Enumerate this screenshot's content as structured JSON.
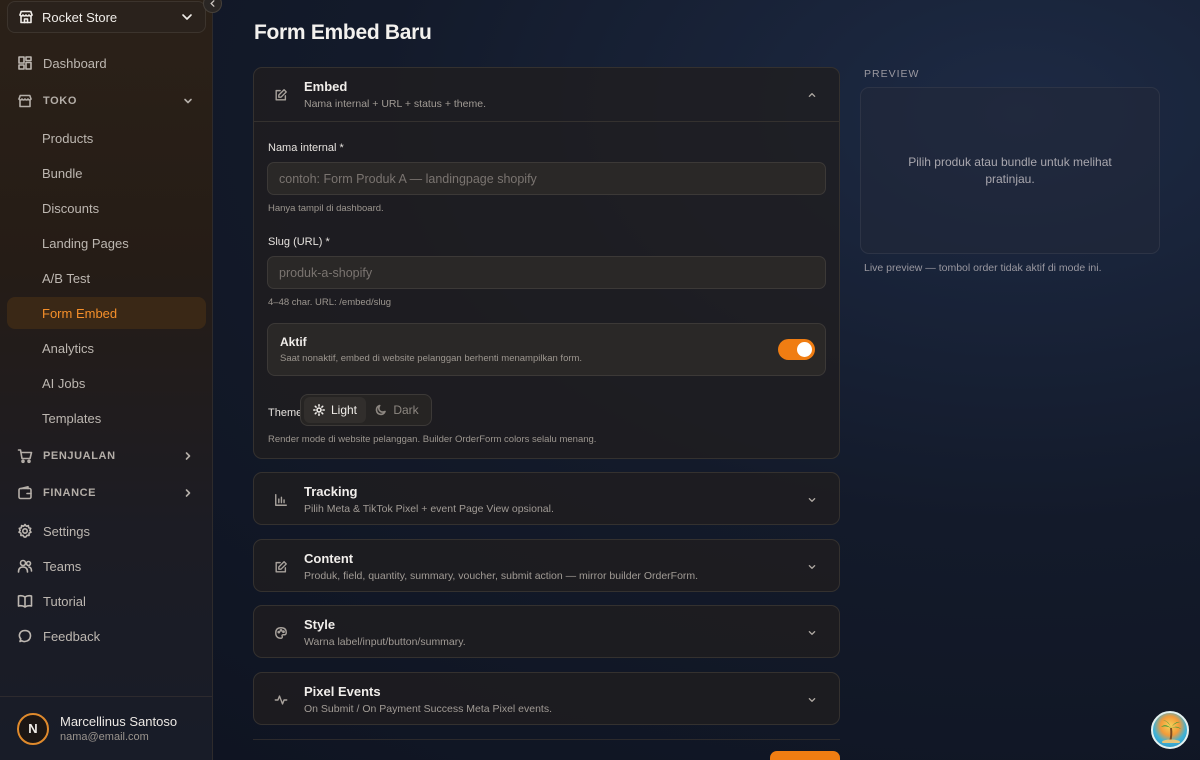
{
  "sidebar": {
    "store": "Rocket Store",
    "items": {
      "dashboard": "Dashboard",
      "toko": "TOKO",
      "products": "Products",
      "bundle": "Bundle",
      "discounts": "Discounts",
      "landing_pages": "Landing Pages",
      "ab_test": "A/B Test",
      "form_embed": "Form Embed",
      "analytics": "Analytics",
      "ai_jobs": "AI Jobs",
      "templates": "Templates",
      "penjualan": "PENJUALAN",
      "finance": "FINANCE",
      "settings": "Settings",
      "teams": "Teams",
      "tutorial": "Tutorial",
      "feedback": "Feedback"
    },
    "active": "Form Embed",
    "user": {
      "initial": "N",
      "name": "Marcellinus Santoso",
      "email": "nama@email.com"
    }
  },
  "page": {
    "title": "Form Embed Baru"
  },
  "embed": {
    "title": "Embed",
    "desc": "Nama internal + URL + status + theme.",
    "name_label": "Nama internal *",
    "name_placeholder": "contoh: Form Produk A — landingpage shopify",
    "name_value": "",
    "name_hint": "Hanya tampil di dashboard.",
    "slug_label": "Slug (URL) *",
    "slug_placeholder": "produk-a-shopify",
    "slug_value": "",
    "slug_hint": "4–48 char. URL: /embed/slug",
    "active_title": "Aktif",
    "active_desc": "Saat nonaktif, embed di website pelanggan berhenti menampilkan form.",
    "active_on": true,
    "theme_label": "Theme",
    "theme_light": "Light",
    "theme_dark": "Dark",
    "theme_selected": "Light",
    "theme_hint": "Render mode di website pelanggan. Builder OrderForm colors selalu menang."
  },
  "sections": {
    "tracking": {
      "title": "Tracking",
      "desc": "Pilih Meta & TikTok Pixel + event Page View opsional."
    },
    "content": {
      "title": "Content",
      "desc": "Produk, field, quantity, summary, voucher, submit action — mirror builder OrderForm."
    },
    "style": {
      "title": "Style",
      "desc": "Warna label/input/button/summary."
    },
    "pixel": {
      "title": "Pixel Events",
      "desc": "On Submit / On Payment Success Meta Pixel events."
    }
  },
  "preview": {
    "label": "PREVIEW",
    "empty": "Pilih produk atau bundle untuk melihat pratinjau.",
    "note": "Live preview — tombol order tidak aktif di mode ini."
  },
  "colors": {
    "accent": "#f07d12",
    "active_bg": "#3a2816",
    "active_text": "#f58f2a"
  }
}
